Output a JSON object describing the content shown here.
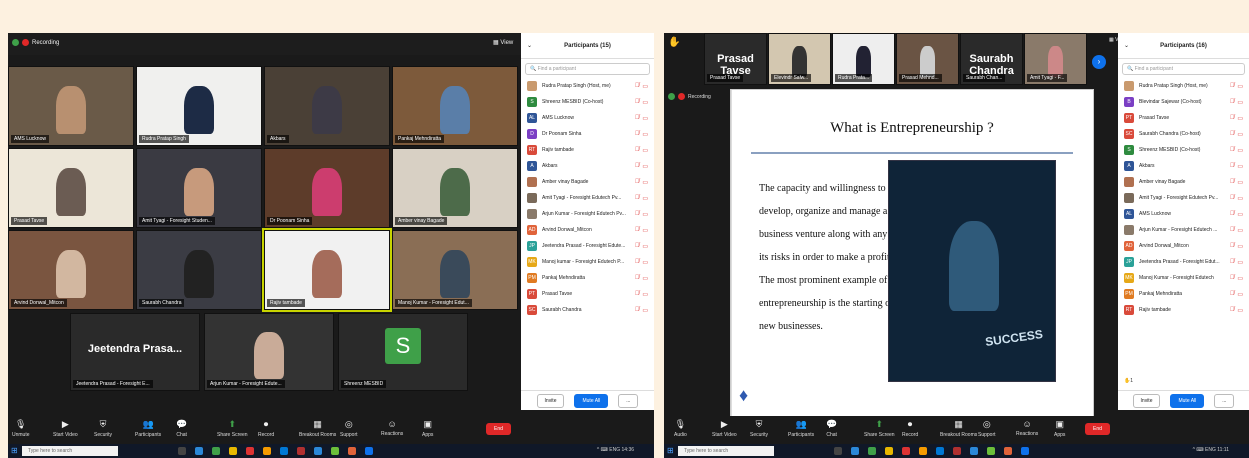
{
  "left": {
    "recording": "Recording",
    "view": "View",
    "tiles": [
      {
        "name": "AMS Lucknow",
        "bg": "#6a5a48",
        "p": "#b89070"
      },
      {
        "name": "Rudra Pratap Singh",
        "bg": "#f0f0ee",
        "p": "#1d2b45"
      },
      {
        "name": "Akbars",
        "bg": "#4a4036",
        "p": "#3d3a46"
      },
      {
        "name": "Pankaj Mehndiratta",
        "bg": "#7d5a3b",
        "p": "#5a7ea8"
      },
      {
        "name": "Prasad Tavse",
        "bg": "#ece6d8",
        "p": "#6b5c53"
      },
      {
        "name": "Amit Tyagi - Foresight Studen...",
        "bg": "#3a3a42",
        "p": "#c79a7c"
      },
      {
        "name": "Dr Poonam Sinha",
        "bg": "#5d3c2a",
        "p": "#cc3d6e"
      },
      {
        "name": "Amber vinay Bagade",
        "bg": "#d8d0c4",
        "p": "#4d6b4a"
      },
      {
        "name": "Arvind Donwal_Mitcon",
        "bg": "#7a5540",
        "p": "#d2b7a0"
      },
      {
        "name": "Saurabh Chandra",
        "bg": "#3b3c44",
        "p": "#222"
      },
      {
        "name": "Rajiv tambade",
        "bg": "#f1f1f1",
        "p": "#a56c5b"
      },
      {
        "name": "Manoj Kumar - Foresight Edut...",
        "bg": "#8a6e55",
        "p": "#3a4a5a"
      },
      {
        "name": "Jeetendra Prasad - Foresight E...",
        "big": "Jeetendra  Prasa..."
      },
      {
        "name": "Arjun Kumar - Foresight Edute...",
        "bg": "#333",
        "p": "#c9ab98"
      },
      {
        "name": "Shreenz MESBID",
        "letter": "S"
      }
    ],
    "panel": {
      "title": "Participants (15)",
      "search": "Find a participant",
      "rows": [
        {
          "initial": "",
          "name": "Rudra Pratap Singh (Host, me)",
          "color": "#c99a6e"
        },
        {
          "initial": "S",
          "name": "Shreenz MESBID (Co-host)",
          "color": "#2e8b3f"
        },
        {
          "initial": "AL",
          "name": "AMS Lucknow",
          "color": "#2f5597"
        },
        {
          "initial": "D",
          "name": "Dr Poonam Sinha",
          "color": "#7b3fc4"
        },
        {
          "initial": "RT",
          "name": "Rajiv tambade",
          "color": "#d94a3a"
        },
        {
          "initial": "A",
          "name": "Akbars",
          "color": "#2f5597"
        },
        {
          "initial": "",
          "name": "Amber vinay Bagade",
          "color": "#b07050"
        },
        {
          "initial": "",
          "name": "Amit Tyagi - Foresight Edutech Pv...",
          "color": "#7a6a5a"
        },
        {
          "initial": "",
          "name": "Arjun Kumar - Foresight Edutech Pv...",
          "color": "#8a7a6a"
        },
        {
          "initial": "AD",
          "name": "Arvind Donwal_Mitcon",
          "color": "#e0633a"
        },
        {
          "initial": "JP",
          "name": "Jeetendra Prasad - Foresight Edute...",
          "color": "#2aa198"
        },
        {
          "initial": "MK",
          "name": "Manoj kumar - Foresight Edutech P...",
          "color": "#e6a817"
        },
        {
          "initial": "PM",
          "name": "Pankaj Mehndiratta",
          "color": "#e07b22"
        },
        {
          "initial": "PT",
          "name": "Prasad Tavse",
          "color": "#d94a3a"
        },
        {
          "initial": "SC",
          "name": "Saurabh Chandra",
          "color": "#d94a3a"
        }
      ],
      "invite": "Invite",
      "mute_all": "Mute All",
      "more": "..."
    },
    "toolbar": [
      "Unmute",
      "Start Video",
      "Security",
      "Participants",
      "Chat",
      "Share Screen",
      "Record",
      "Breakout Rooms",
      "Support",
      "Reactions",
      "Apps"
    ],
    "end": "End",
    "taskbar_search": "Type here to search",
    "tray": "^  ⌨  ENG  14:36"
  },
  "right": {
    "strip": [
      {
        "name": "Prasad Tavse",
        "big": "Prasad Tavse"
      },
      {
        "name": "Elevindr Salw...",
        "bg": "#d3c7b0",
        "p": "#333"
      },
      {
        "name": "Rudra Prata...",
        "bg": "#eee",
        "p": "#223"
      },
      {
        "name": "Prasad Mehnd...",
        "bg": "#6a5444",
        "p": "#ccc"
      },
      {
        "name": "Saurabh Chan...",
        "big": "Saurabh Chandra"
      },
      {
        "name": "Amit Tyagi - F...",
        "bg": "#8a7a6a",
        "p": "#c88"
      }
    ],
    "view": "View",
    "recording": "Recording",
    "slide": {
      "title": "What is Entrepreneurship ?",
      "body": "The capacity and willingness to develop, organize and manage a business venture along with any of its risks in order to make a profit. The most prominent example of entrepreneurship is the starting of new businesses.",
      "board": "SUCCESS"
    },
    "panel": {
      "title": "Participants (16)",
      "search": "Find a participant",
      "rows": [
        {
          "initial": "",
          "name": "Rudra Pratap Singh (Host, me)",
          "color": "#c99a6e"
        },
        {
          "initial": "B",
          "name": "Blevindar Sajewar (Co-host)",
          "color": "#7b3fc4"
        },
        {
          "initial": "PT",
          "name": "Prasad Tavse",
          "color": "#d94a3a"
        },
        {
          "initial": "SC",
          "name": "Saurabh Chandra (Co-host)",
          "color": "#d94a3a"
        },
        {
          "initial": "S",
          "name": "Shreenz MESBID (Co-host)",
          "color": "#2e8b3f"
        },
        {
          "initial": "A",
          "name": "Akbars",
          "color": "#2f5597"
        },
        {
          "initial": "",
          "name": "Amber vinay Bagade",
          "color": "#b07050"
        },
        {
          "initial": "",
          "name": "Amit Tyagi - Foresight Edutech Pv...",
          "color": "#7a6a5a"
        },
        {
          "initial": "AL",
          "name": "AMS Lucknow",
          "color": "#2f5597"
        },
        {
          "initial": "",
          "name": "Arjun Kumar - Foresight Edutech ...",
          "color": "#8a7a6a"
        },
        {
          "initial": "AD",
          "name": "Arvind Donwal_Mitcon",
          "color": "#e0633a"
        },
        {
          "initial": "JP",
          "name": "Jeetendra Prasad - Foresight Edut...",
          "color": "#2aa198"
        },
        {
          "initial": "MK",
          "name": "Manoj Kumar - Foresight Edutech",
          "color": "#e6a817"
        },
        {
          "initial": "PM",
          "name": "Pankaj Mehndiratta",
          "color": "#e07b22"
        },
        {
          "initial": "RT",
          "name": "Rajiv tambade",
          "color": "#d94a3a"
        }
      ],
      "raised": "1",
      "invite": "Invite",
      "mute_all": "Mute All",
      "more": "..."
    },
    "toolbar": [
      "Audio",
      "Start Video",
      "Security",
      "Participants",
      "Chat",
      "Share Screen",
      "Record",
      "Breakout Rooms",
      "Support",
      "Reactions",
      "Apps"
    ],
    "end": "End",
    "taskbar_search": "Type here to search",
    "tray": "^  ⌨  ENG  11:11"
  }
}
